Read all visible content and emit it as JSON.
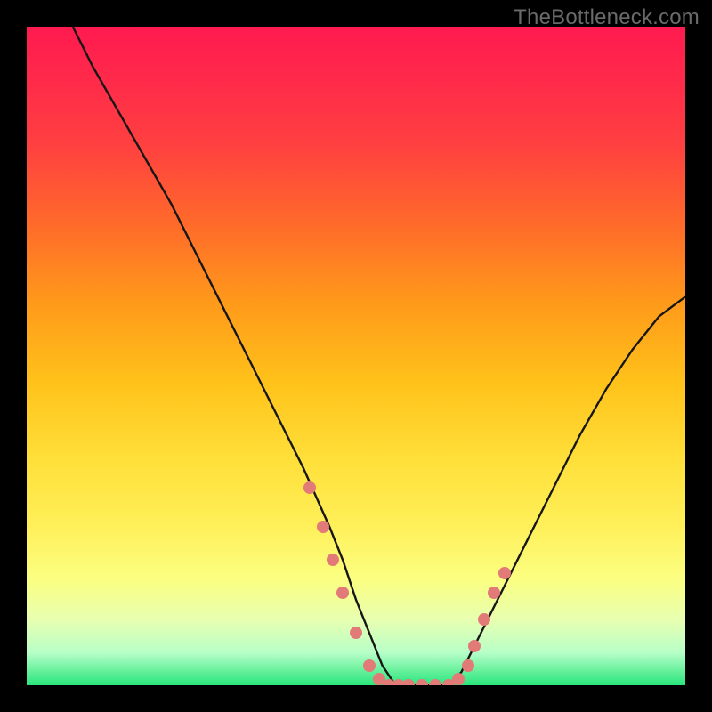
{
  "watermark": "TheBottleneck.com",
  "colors": {
    "background": "#000000",
    "gradient_top": "#ff1a4f",
    "gradient_mid": "#ffd23a",
    "gradient_bottom": "#28e57a",
    "curve_stroke": "#171717",
    "dot_fill": "#e27a78"
  },
  "chart_data": {
    "type": "line",
    "title": "",
    "xlabel": "",
    "ylabel": "",
    "xlim": [
      0,
      100
    ],
    "ylim": [
      0,
      100
    ],
    "grid": false,
    "legend": false,
    "series": [
      {
        "name": "bottleneck-curve",
        "x": [
          7,
          10,
          14,
          18,
          22,
          26,
          30,
          34,
          38,
          42,
          46,
          48,
          50,
          52,
          54,
          56,
          58,
          60,
          62,
          64,
          66,
          68,
          72,
          76,
          80,
          84,
          88,
          92,
          96,
          100
        ],
        "values": [
          100,
          94,
          87,
          80,
          73,
          65,
          57,
          49,
          41,
          33,
          24,
          19,
          13,
          8,
          3,
          0,
          0,
          0,
          0,
          0,
          2,
          6,
          14,
          22,
          30,
          38,
          45,
          51,
          56,
          59
        ]
      }
    ],
    "highlight_dots": {
      "name": "marked-points",
      "x": [
        43,
        45,
        46.5,
        48,
        50,
        52,
        53.5,
        55,
        56.5,
        58,
        60,
        62,
        64,
        65.5,
        67,
        68,
        69.5,
        71,
        72.5
      ],
      "values": [
        30,
        24,
        19,
        14,
        8,
        3,
        1,
        0,
        0,
        0,
        0,
        0,
        0,
        1,
        3,
        6,
        10,
        14,
        17
      ]
    }
  }
}
